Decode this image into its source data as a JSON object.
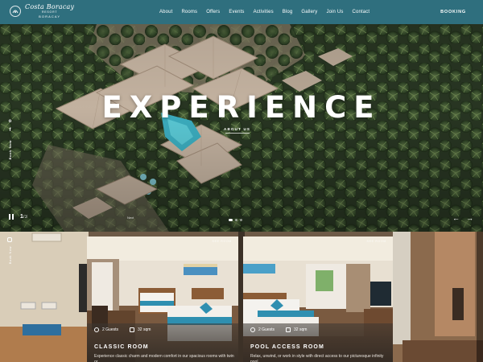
{
  "brand": {
    "name_script": "Costa Boracay",
    "name_sub": "RESORT",
    "name_place": "BORACAY"
  },
  "nav": {
    "items": [
      "About",
      "Rooms",
      "Offers",
      "Events",
      "Activities",
      "Blog",
      "Gallery",
      "Join Us",
      "Contact"
    ],
    "booking_label": "BOOKING"
  },
  "hero": {
    "title": "EXPERIENCE",
    "subtitle": "ABOUT US",
    "slide_current": "1",
    "slide_total": "/3",
    "social_label": "Book Now",
    "next_label": "Next",
    "prev_arrow": "←",
    "next_arrow": "→",
    "pause_icon": "pause-icon",
    "facebook_icon": "f",
    "instagram_icon": "o"
  },
  "rooms_section": {
    "side_label": "Book Now",
    "cards": [
      {
        "title": "CLASSIC ROOM",
        "guests": "2 Guests",
        "size": "32 sqm",
        "description": "Experience classic charm and modern comfort in our spacious rooms with twin or",
        "tag": "SEE ROOM"
      },
      {
        "title": "POOL ACCESS ROOM",
        "guests": "2 Guests",
        "size": "32 sqm",
        "description": "Relax, unwind, or work in style with direct access to our picturesque infinity pool,",
        "tag": "SEE ROOM"
      }
    ]
  },
  "colors": {
    "header_bg": "#2f6f7e",
    "accent_teal": "#2f8fb0",
    "palm_dark": "#2c3a27",
    "roof": "#c9b6a4"
  }
}
